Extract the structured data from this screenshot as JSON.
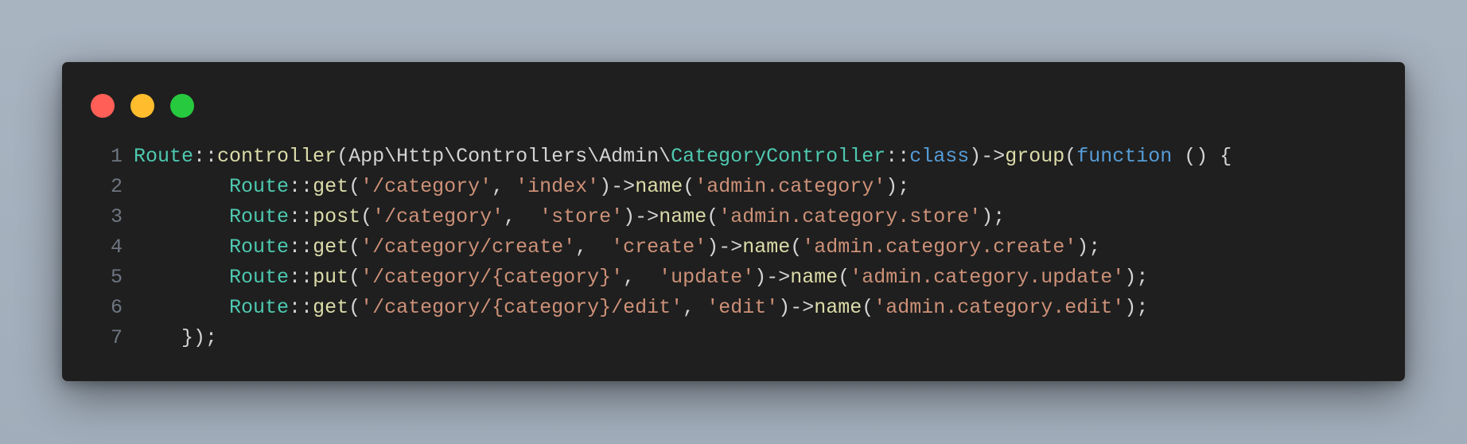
{
  "window": {
    "traffic_lights": [
      {
        "name": "close",
        "color": "#ff5f56"
      },
      {
        "name": "minimize",
        "color": "#ffbd2e"
      },
      {
        "name": "zoom",
        "color": "#27c93f"
      }
    ]
  },
  "colors": {
    "type": "#4ec9b0",
    "function": "#dcdcaa",
    "string": "#ce9178",
    "keyword": "#569cd6",
    "punctuation": "#d4d4d4",
    "line_number": "#6e7681",
    "background": "#1f1f1f"
  },
  "code": {
    "lines": [
      {
        "number": "1",
        "tokens": [
          {
            "t": "Route",
            "k": "type"
          },
          {
            "t": "::",
            "k": "punc"
          },
          {
            "t": "controller",
            "k": "fn"
          },
          {
            "t": "(App\\Http\\Controllers\\Admin\\",
            "k": "ns"
          },
          {
            "t": "CategoryController",
            "k": "type"
          },
          {
            "t": "::",
            "k": "punc"
          },
          {
            "t": "class",
            "k": "kw"
          },
          {
            "t": ")->",
            "k": "punc"
          },
          {
            "t": "group",
            "k": "fn"
          },
          {
            "t": "(",
            "k": "punc"
          },
          {
            "t": "function",
            "k": "kw"
          },
          {
            "t": " () {",
            "k": "punc"
          }
        ]
      },
      {
        "number": "2",
        "tokens": [
          {
            "t": "        ",
            "k": "punc"
          },
          {
            "t": "Route",
            "k": "type"
          },
          {
            "t": "::",
            "k": "punc"
          },
          {
            "t": "get",
            "k": "fn"
          },
          {
            "t": "(",
            "k": "punc"
          },
          {
            "t": "'/category'",
            "k": "str"
          },
          {
            "t": ", ",
            "k": "punc"
          },
          {
            "t": "'index'",
            "k": "str"
          },
          {
            "t": ")->",
            "k": "punc"
          },
          {
            "t": "name",
            "k": "fn"
          },
          {
            "t": "(",
            "k": "punc"
          },
          {
            "t": "'admin.category'",
            "k": "str"
          },
          {
            "t": ");",
            "k": "punc"
          }
        ]
      },
      {
        "number": "3",
        "tokens": [
          {
            "t": "        ",
            "k": "punc"
          },
          {
            "t": "Route",
            "k": "type"
          },
          {
            "t": "::",
            "k": "punc"
          },
          {
            "t": "post",
            "k": "fn"
          },
          {
            "t": "(",
            "k": "punc"
          },
          {
            "t": "'/category'",
            "k": "str"
          },
          {
            "t": ",  ",
            "k": "punc"
          },
          {
            "t": "'store'",
            "k": "str"
          },
          {
            "t": ")->",
            "k": "punc"
          },
          {
            "t": "name",
            "k": "fn"
          },
          {
            "t": "(",
            "k": "punc"
          },
          {
            "t": "'admin.category.store'",
            "k": "str"
          },
          {
            "t": ");",
            "k": "punc"
          }
        ]
      },
      {
        "number": "4",
        "tokens": [
          {
            "t": "        ",
            "k": "punc"
          },
          {
            "t": "Route",
            "k": "type"
          },
          {
            "t": "::",
            "k": "punc"
          },
          {
            "t": "get",
            "k": "fn"
          },
          {
            "t": "(",
            "k": "punc"
          },
          {
            "t": "'/category/create'",
            "k": "str"
          },
          {
            "t": ",  ",
            "k": "punc"
          },
          {
            "t": "'create'",
            "k": "str"
          },
          {
            "t": ")->",
            "k": "punc"
          },
          {
            "t": "name",
            "k": "fn"
          },
          {
            "t": "(",
            "k": "punc"
          },
          {
            "t": "'admin.category.create'",
            "k": "str"
          },
          {
            "t": ");",
            "k": "punc"
          }
        ]
      },
      {
        "number": "5",
        "tokens": [
          {
            "t": "        ",
            "k": "punc"
          },
          {
            "t": "Route",
            "k": "type"
          },
          {
            "t": "::",
            "k": "punc"
          },
          {
            "t": "put",
            "k": "fn"
          },
          {
            "t": "(",
            "k": "punc"
          },
          {
            "t": "'/category/{category}'",
            "k": "str"
          },
          {
            "t": ",  ",
            "k": "punc"
          },
          {
            "t": "'update'",
            "k": "str"
          },
          {
            "t": ")->",
            "k": "punc"
          },
          {
            "t": "name",
            "k": "fn"
          },
          {
            "t": "(",
            "k": "punc"
          },
          {
            "t": "'admin.category.update'",
            "k": "str"
          },
          {
            "t": ");",
            "k": "punc"
          }
        ]
      },
      {
        "number": "6",
        "tokens": [
          {
            "t": "        ",
            "k": "punc"
          },
          {
            "t": "Route",
            "k": "type"
          },
          {
            "t": "::",
            "k": "punc"
          },
          {
            "t": "get",
            "k": "fn"
          },
          {
            "t": "(",
            "k": "punc"
          },
          {
            "t": "'/category/{category}/edit'",
            "k": "str"
          },
          {
            "t": ", ",
            "k": "punc"
          },
          {
            "t": "'edit'",
            "k": "str"
          },
          {
            "t": ")->",
            "k": "punc"
          },
          {
            "t": "name",
            "k": "fn"
          },
          {
            "t": "(",
            "k": "punc"
          },
          {
            "t": "'admin.category.edit'",
            "k": "str"
          },
          {
            "t": ");",
            "k": "punc"
          }
        ]
      },
      {
        "number": "7",
        "tokens": [
          {
            "t": "    });",
            "k": "punc"
          }
        ]
      }
    ]
  }
}
